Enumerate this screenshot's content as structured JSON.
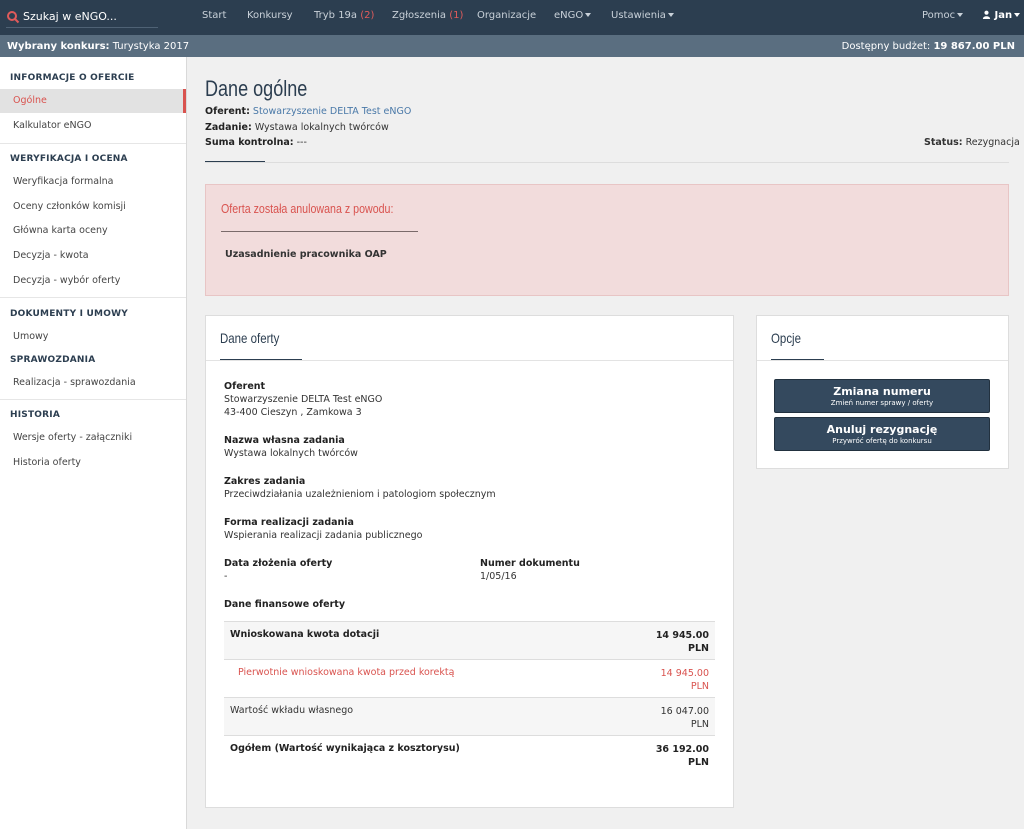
{
  "topnav": {
    "search_label": "Szukaj w eNGO...",
    "items": [
      {
        "label": "Start"
      },
      {
        "label": "Konkursy"
      },
      {
        "label": "Tryb 19a",
        "count": "(2)"
      },
      {
        "label": "Zgłoszenia",
        "count": "(1)"
      },
      {
        "label": "Organizacje"
      },
      {
        "label": "eNGO"
      },
      {
        "label": "Ustawienia"
      },
      {
        "label": "Pomoc"
      }
    ],
    "user": "Jan"
  },
  "subbar": {
    "contest_label": "Wybrany konkurs:",
    "contest_value": "Turystyka 2017",
    "budget_label": "Dostępny budżet:",
    "budget_value": "19 867.00 PLN"
  },
  "sidebar": {
    "sections": [
      {
        "title": "INFORMACJE O OFERCIE",
        "items": [
          "Ogólne",
          "Kalkulator eNGO"
        ]
      },
      {
        "title": "WERYFIKACJA I OCENA",
        "items": [
          "Weryfikacja formalna",
          "Oceny członków komisji",
          "Główna karta oceny",
          "Decyzja - kwota",
          "Decyzja - wybór oferty"
        ]
      },
      {
        "title": "DOKUMENTY I UMOWY",
        "items": [
          "Umowy"
        ]
      },
      {
        "title": "SPRAWOZDANIA",
        "items": [
          "Realizacja - sprawozdania"
        ]
      },
      {
        "title": "HISTORIA",
        "items": [
          "Wersje oferty - załączniki",
          "Historia oferty"
        ]
      }
    ]
  },
  "header": {
    "title": "Dane ogólne",
    "oferent_label": "Oferent:",
    "oferent_value": "Stowarzyszenie DELTA Test eNGO",
    "zadanie_label": "Zadanie:",
    "zadanie_value": "Wystawa lokalnych twórców",
    "suma_label": "Suma kontrolna:",
    "suma_value": "---",
    "status_label": "Status:",
    "status_value": "Rezygnacja"
  },
  "alert": {
    "title": "Oferta została anulowana z powodu:",
    "reason": "Uzasadnienie pracownika OAP"
  },
  "offer_panel": {
    "title": "Dane oferty",
    "oferent_label": "Oferent",
    "oferent_name": "Stowarzyszenie DELTA Test eNGO",
    "oferent_address": "43-400 Cieszyn , Zamkowa 3",
    "task_name_label": "Nazwa własna zadania",
    "task_name_value": "Wystawa lokalnych twórców",
    "scope_label": "Zakres zadania",
    "scope_value": "Przeciwdziałania uzależnieniom i patologiom społecznym",
    "form_label": "Forma realizacji zadania",
    "form_value": "Wspierania realizacji zadania publicznego",
    "date_label": "Data złożenia oferty",
    "date_value": "-",
    "docnum_label": "Numer dokumentu",
    "docnum_value": "1/05/16",
    "finance_label": "Dane finansowe oferty",
    "finance_rows": [
      {
        "label": "Wnioskowana kwota dotacji",
        "amount": "14 945.00",
        "currency": "PLN"
      },
      {
        "label": "Pierwotnie wnioskowana kwota przed korektą",
        "amount": "14 945.00",
        "currency": "PLN"
      },
      {
        "label": "Wartość wkładu własnego",
        "amount": "16 047.00",
        "currency": "PLN"
      },
      {
        "label": "Ogółem (Wartość wynikająca z kosztorysu)",
        "amount": "36 192.00",
        "currency": "PLN"
      }
    ]
  },
  "options_panel": {
    "title": "Opcje",
    "buttons": [
      {
        "title": "Zmiana numeru",
        "subtitle": "Zmień numer sprawy / oferty"
      },
      {
        "title": "Anuluj rezygnację",
        "subtitle": "Przywróć ofertę do konkursu"
      }
    ]
  },
  "colors": {
    "nav_bg": "#2c3e50",
    "subbar_bg": "#5a6e80",
    "accent_red": "#d9534f",
    "button_bg": "#34495e",
    "alert_bg": "#f2dcdc"
  }
}
